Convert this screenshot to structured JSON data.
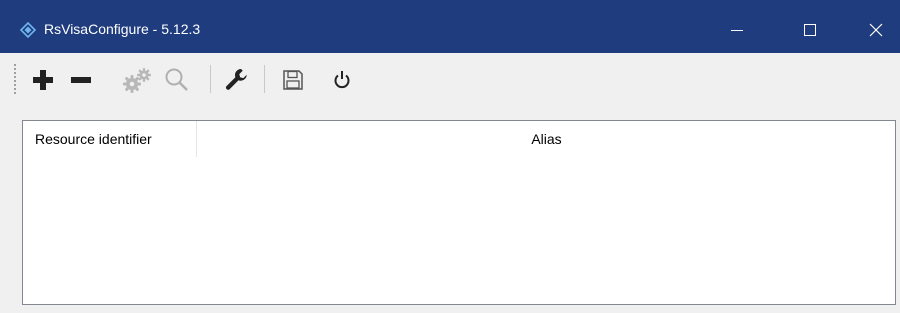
{
  "window": {
    "title": "RsVisaConfigure - 5.12.3",
    "app_icon": "rs-diamond-icon",
    "titlebar_color": "#1e3c7e",
    "controls": [
      "minimize-icon",
      "maximize-icon",
      "close-icon"
    ]
  },
  "toolbar": {
    "items": [
      "add-icon",
      "remove-icon",
      "settings-gears-icon",
      "search-icon",
      "wrench-icon",
      "save-icon",
      "power-icon"
    ]
  },
  "table": {
    "columns": [
      "Resource identifier",
      "Alias"
    ],
    "rows": []
  }
}
